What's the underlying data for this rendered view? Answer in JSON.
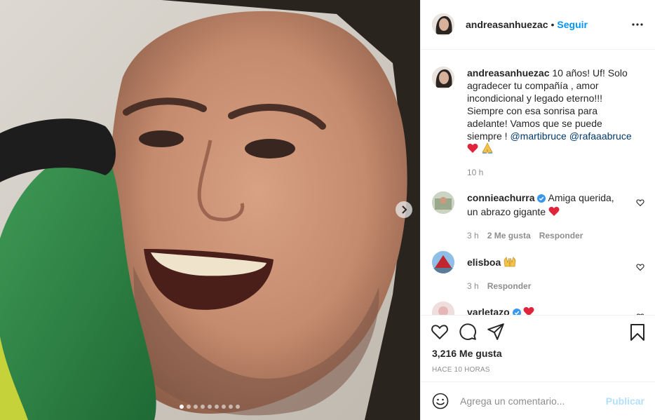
{
  "post": {
    "image_alt": "Smiling man holding a green object against his cheek",
    "carousel_count": 9,
    "carousel_active": 1
  },
  "header": {
    "username": "andreasanhuezac",
    "separator": "•",
    "follow_label": "Seguir"
  },
  "caption": {
    "username": "andreasanhuezac",
    "text": " 10 años! Uf! Solo agradecer tu compañía , amor incondicional y legado eterno!!! Siempre con esa sonrisa para adelante! Vamos que se puede siempre ! ",
    "mention_1": "@martibruce",
    "mention_2": "@rafaaabruce",
    "time": "10 h"
  },
  "comments": [
    {
      "username": "conniеachurra",
      "verified": true,
      "text": " Amiga querida, un abrazo gigante ",
      "time": "3 h",
      "likes": "2 Me gusta",
      "reply": "Responder"
    },
    {
      "username": "elisboa",
      "verified": false,
      "text": "",
      "time": "3 h",
      "reply": "Responder"
    },
    {
      "username": "varletazo",
      "verified": true,
      "text": ""
    }
  ],
  "actions": {
    "likes": "3,216 Me gusta",
    "timestamp": "HACE 10 HORAS"
  },
  "add_comment": {
    "placeholder": "Agrega un comentario...",
    "post_label": "Publicar"
  },
  "colors": {
    "link": "#0095f6",
    "mention": "#00376b",
    "muted": "#8e8e8e",
    "heart": "#ed4956",
    "verified": "#3897f0",
    "post_disabled": "#b2dffc"
  }
}
